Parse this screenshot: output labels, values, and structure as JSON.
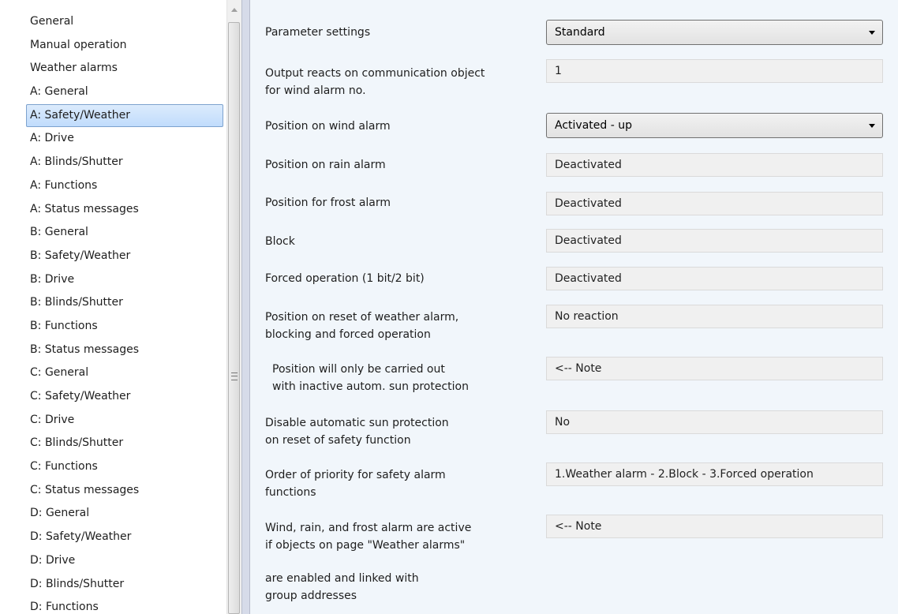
{
  "sidebar": {
    "items": [
      {
        "label": "General"
      },
      {
        "label": "Manual operation"
      },
      {
        "label": "Weather alarms"
      },
      {
        "label": "A: General"
      },
      {
        "label": "A: Safety/Weather",
        "selected": true
      },
      {
        "label": "A: Drive"
      },
      {
        "label": "A: Blinds/Shutter"
      },
      {
        "label": "A: Functions"
      },
      {
        "label": "A: Status messages"
      },
      {
        "label": "B: General"
      },
      {
        "label": "B: Safety/Weather"
      },
      {
        "label": "B: Drive"
      },
      {
        "label": "B: Blinds/Shutter"
      },
      {
        "label": "B: Functions"
      },
      {
        "label": "B: Status messages"
      },
      {
        "label": "C: General"
      },
      {
        "label": "C: Safety/Weather"
      },
      {
        "label": "C: Drive"
      },
      {
        "label": "C: Blinds/Shutter"
      },
      {
        "label": "C: Functions"
      },
      {
        "label": "C: Status messages"
      },
      {
        "label": "D: General"
      },
      {
        "label": "D: Safety/Weather"
      },
      {
        "label": "D: Drive"
      },
      {
        "label": "D: Blinds/Shutter"
      },
      {
        "label": "D: Functions"
      }
    ]
  },
  "params": {
    "p1": {
      "label": "Parameter settings",
      "value": "Standard"
    },
    "p2": {
      "label1": "Output reacts on communication object",
      "label2": "for wind alarm no.",
      "value": "1"
    },
    "p3": {
      "label": "Position on wind alarm",
      "value": "Activated - up"
    },
    "p4": {
      "label": "Position on rain alarm",
      "value": "Deactivated"
    },
    "p5": {
      "label": "Position for frost alarm",
      "value": "Deactivated"
    },
    "p6": {
      "label": "Block",
      "value": "Deactivated"
    },
    "p7": {
      "label": "Forced operation (1 bit/2 bit)",
      "value": "Deactivated"
    },
    "p8": {
      "label1": "Position on reset of weather alarm,",
      "label2": "blocking and forced operation",
      "value": "No reaction"
    },
    "p9": {
      "label1": "Position will only be carried out",
      "label2": "with inactive autom. sun protection",
      "value": "<-- Note"
    },
    "p10": {
      "label1": "Disable automatic sun protection",
      "label2": "on reset of safety function",
      "value": "No"
    },
    "p11": {
      "label1": "Order of priority for safety alarm",
      "label2": "functions",
      "value": "1.Weather alarm - 2.Block - 3.Forced operation"
    },
    "p12": {
      "label1": "Wind, rain, and frost alarm are active",
      "label2": "if objects on page \"Weather alarms\"",
      "value": "<-- Note"
    },
    "p13": {
      "label1": "are enabled and linked with",
      "label2": "group addresses"
    }
  },
  "colors": {
    "selected_bg": "#c1dcfc",
    "content_bg": "#f1f6fb",
    "splitter": "#d6dbe9"
  }
}
